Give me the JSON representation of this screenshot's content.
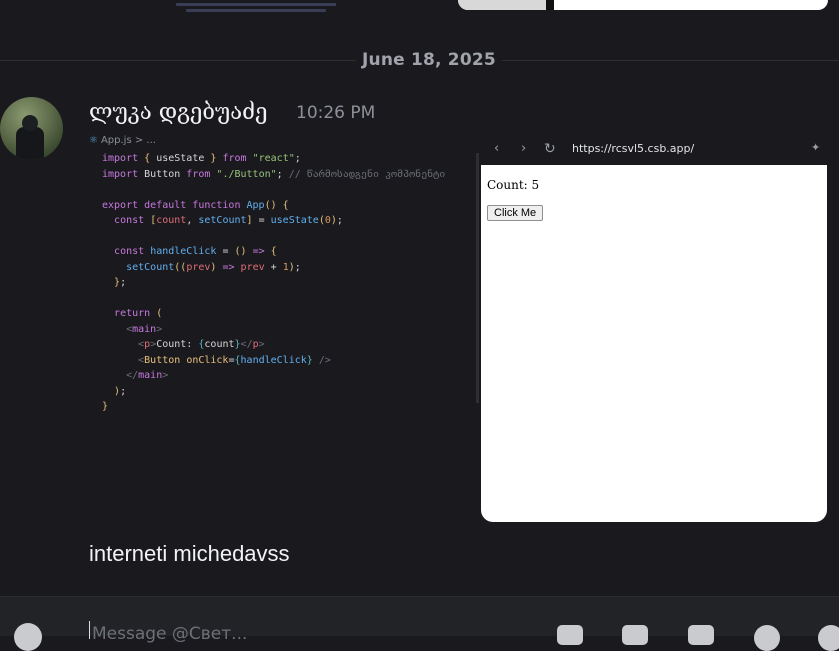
{
  "date_divider": "June 18, 2025",
  "message": {
    "author": "ლუკა დგებუაძე",
    "time": "10:26 PM",
    "text": "interneti michedavss"
  },
  "editor": {
    "breadcrumb": "App.js > ...",
    "code_lines": [
      "import { useState } from \"react\";",
      "import Button from \"./Button\"; // წარმოსადგენი კომპონენტი",
      "",
      "export default function App() {",
      "  const [count, setCount] = useState(0);",
      "",
      "  const handleClick = () => {",
      "    setCount((prev) => prev + 1);",
      "  };",
      "",
      "  return (",
      "    <main>",
      "      <p>Count: {count}</p>",
      "      <Button onClick={handleClick} />",
      "    </main>",
      "  );",
      "}"
    ]
  },
  "browser": {
    "url": "https://rcsvl5.csb.app/",
    "back_icon": "chevron-left-icon",
    "forward_icon": "chevron-right-icon",
    "reload_icon": "reload-icon",
    "preview_count_text": "Count: 5",
    "preview_button_label": "Click Me"
  },
  "composer": {
    "placeholder": "Message @Свет..."
  },
  "colors": {
    "background": "#1a1a1e",
    "preview_bg": "#ffffff"
  }
}
